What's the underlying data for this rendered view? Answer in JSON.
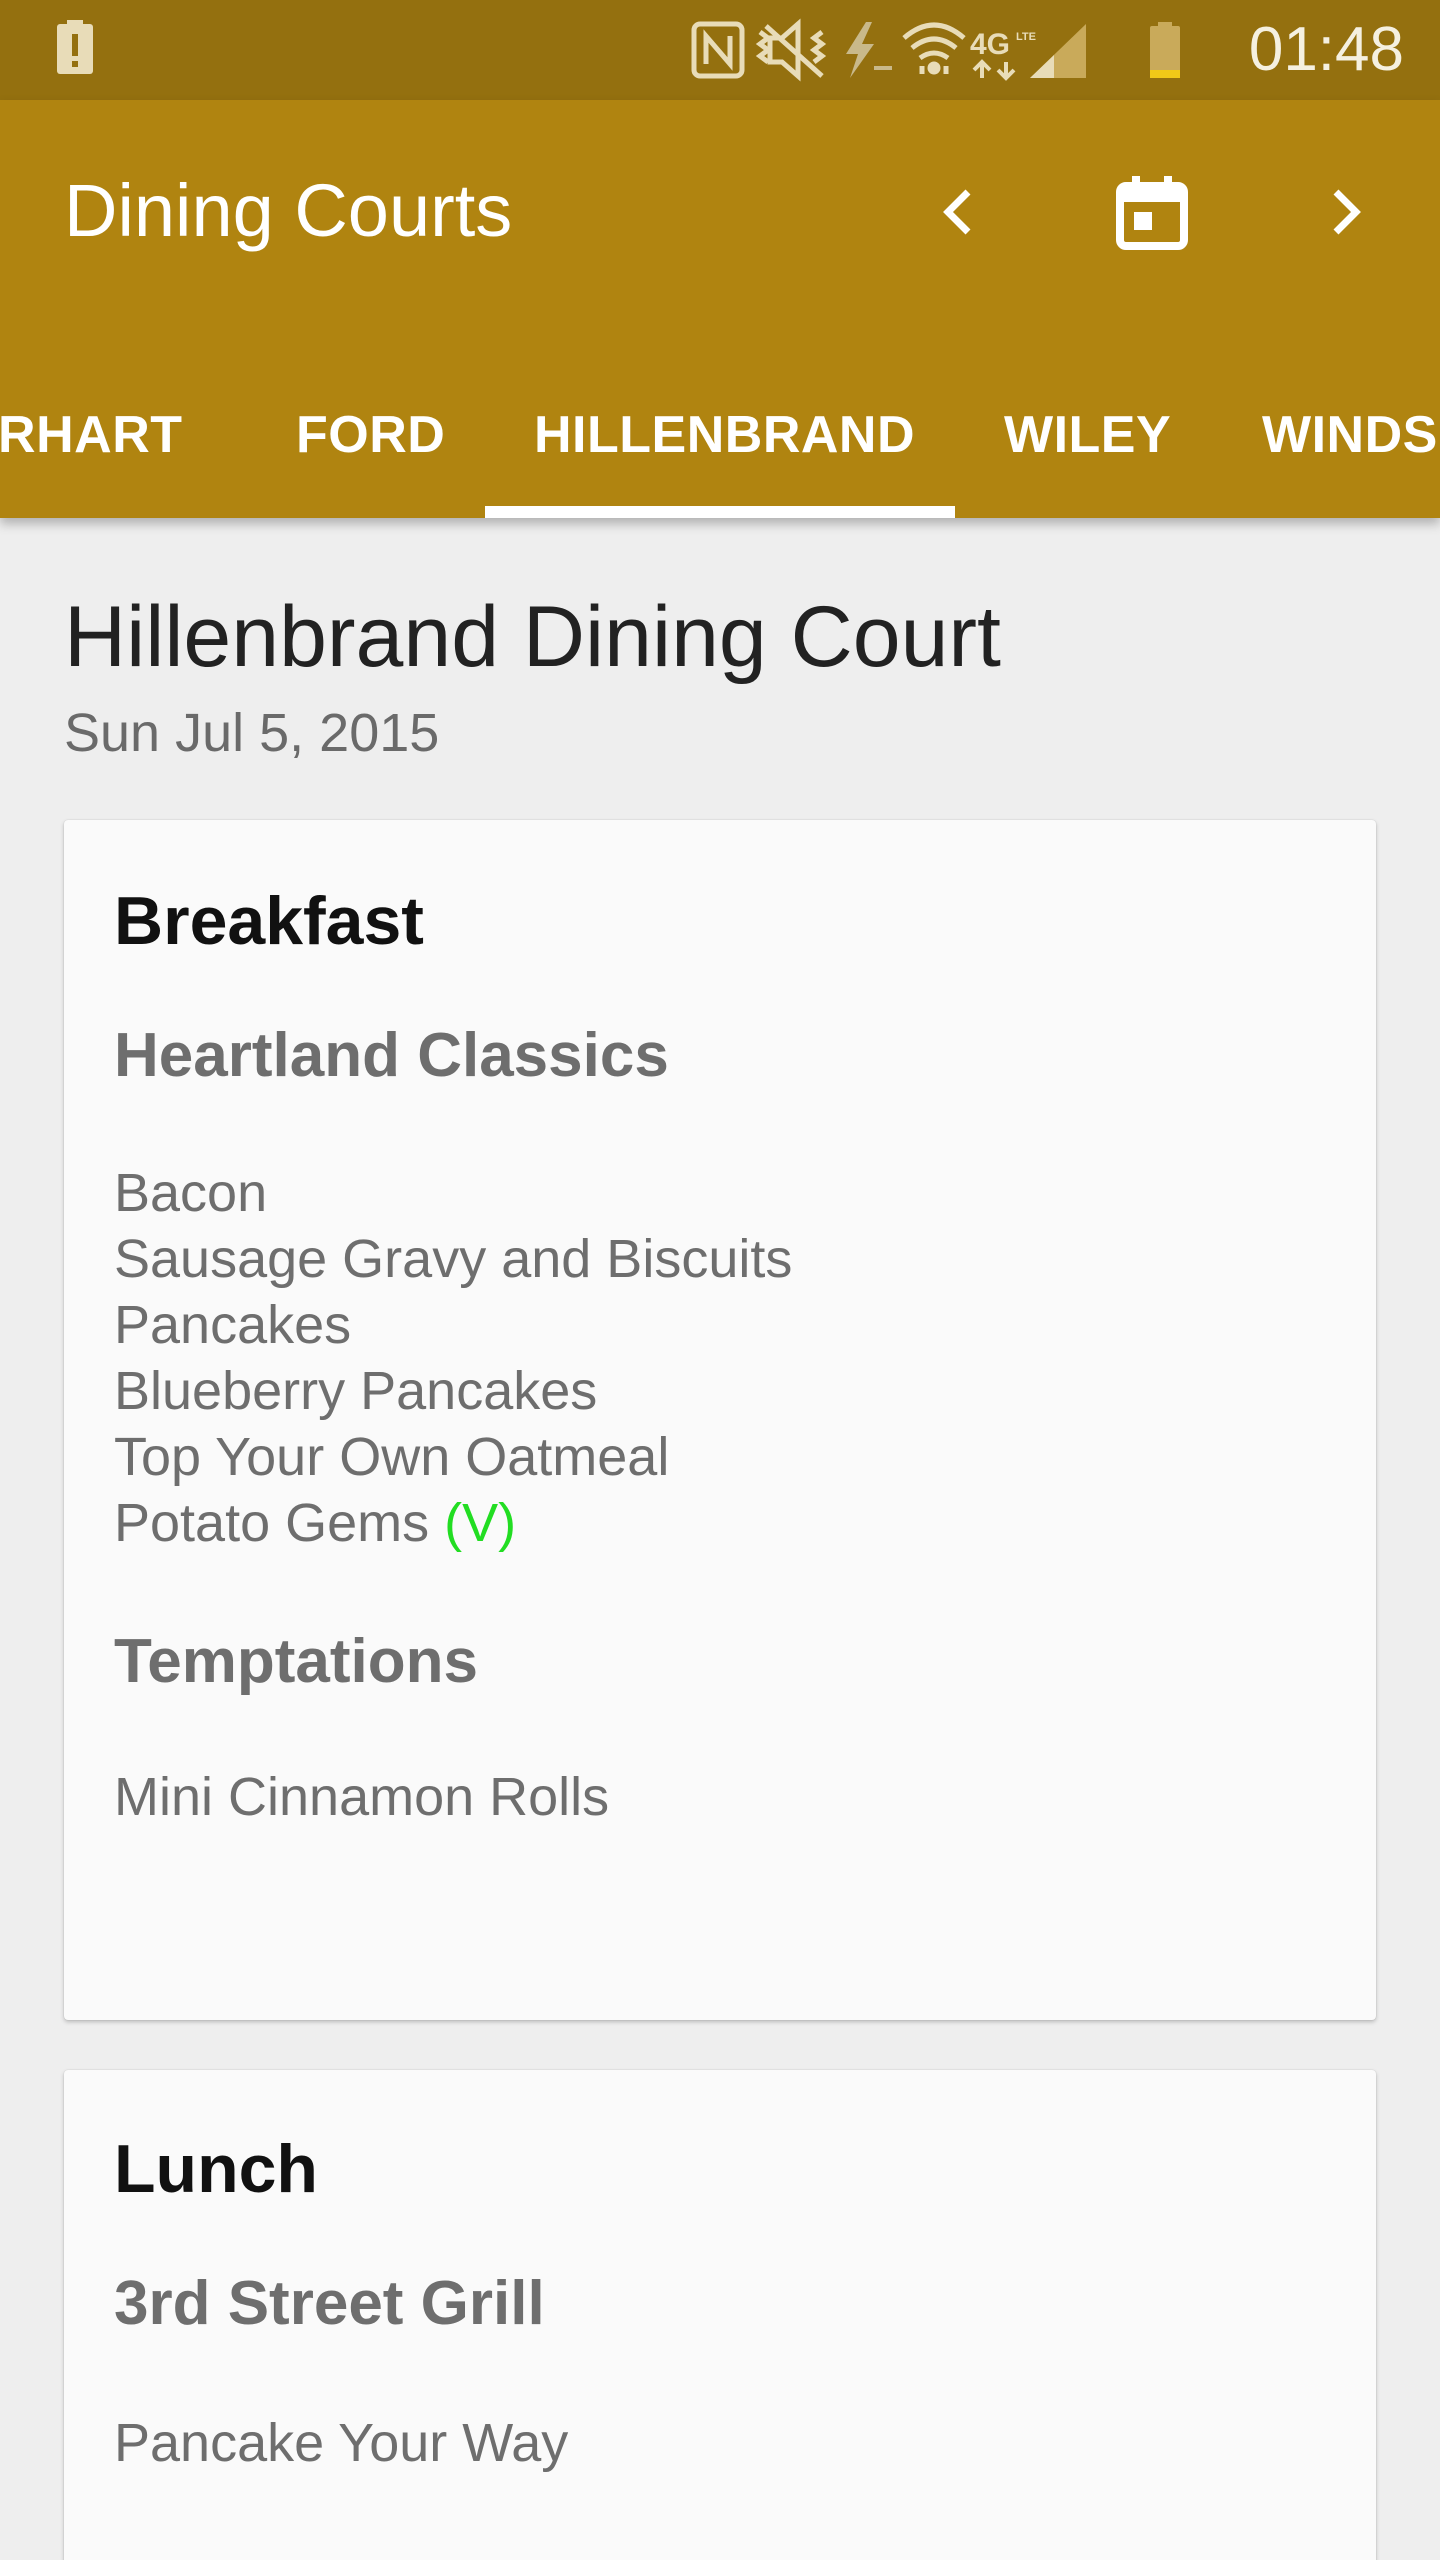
{
  "status_bar": {
    "time": "01:48",
    "icons": [
      "alert-icon",
      "nfc-icon",
      "vibrate-icon",
      "charging-icon",
      "wifi-icon",
      "4g-lte-icon",
      "signal-icon",
      "battery-icon"
    ]
  },
  "app_bar": {
    "title": "Dining Courts",
    "buttons": [
      "chevron-left-icon",
      "calendar-icon",
      "chevron-right-icon"
    ],
    "tabs": [
      {
        "label": "ARHART"
      },
      {
        "label": "FORD"
      },
      {
        "label": "HILLENBRAND",
        "selected": true
      },
      {
        "label": "WILEY"
      },
      {
        "label": "WINDS"
      }
    ]
  },
  "page": {
    "title": "Hillenbrand Dining Court",
    "date": "Sun Jul 5, 2015"
  },
  "meals": [
    {
      "name": "Breakfast",
      "stations": [
        {
          "name": "Heartland Classics",
          "items": [
            {
              "name": "Bacon"
            },
            {
              "name": "Sausage Gravy and Biscuits"
            },
            {
              "name": "Pancakes"
            },
            {
              "name": "Blueberry Pancakes"
            },
            {
              "name": "Top Your Own Oatmeal"
            },
            {
              "name": "Potato Gems",
              "tag": "(V)"
            }
          ]
        },
        {
          "name": "Temptations",
          "items": [
            {
              "name": "Mini Cinnamon Rolls"
            }
          ]
        }
      ]
    },
    {
      "name": "Lunch",
      "stations": [
        {
          "name": "3rd Street Grill",
          "items": [
            {
              "name": "Pancake Your Way"
            }
          ]
        }
      ]
    }
  ],
  "colors": {
    "status_bar": "#94700f",
    "app_bar": "#b08410",
    "background": "#eeeeee",
    "card": "#fafafa",
    "vegetarian_tag": "#22dd22"
  }
}
